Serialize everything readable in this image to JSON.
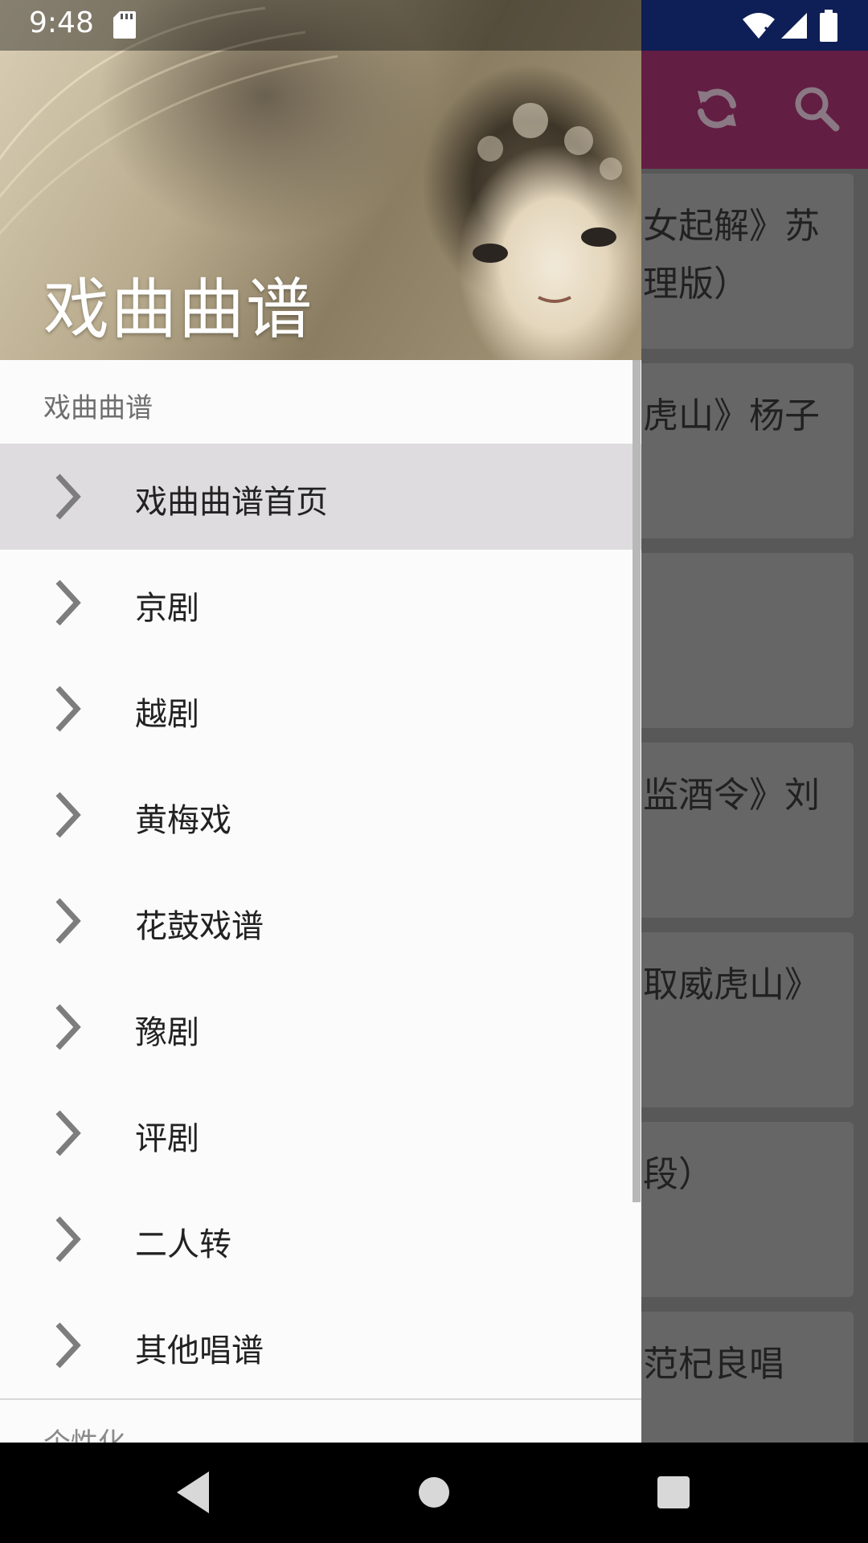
{
  "status": {
    "time": "9:48"
  },
  "drawer": {
    "title": "戏曲曲谱",
    "section_label": "戏曲曲谱",
    "items": [
      {
        "label": "戏曲曲谱首页",
        "active": true
      },
      {
        "label": "京剧"
      },
      {
        "label": "越剧"
      },
      {
        "label": "黄梅戏"
      },
      {
        "label": "花鼓戏谱"
      },
      {
        "label": "豫剧"
      },
      {
        "label": "评剧"
      },
      {
        "label": "二人转"
      },
      {
        "label": "其他唱谱"
      }
    ],
    "next_section_label": "个性化"
  },
  "background_list": [
    {
      "text": "女起解》苏\n理版）"
    },
    {
      "text": "虎山》杨子"
    },
    {
      "text": ""
    },
    {
      "text": "监酒令》刘"
    },
    {
      "text": "取威虎山》"
    },
    {
      "text": "段）"
    },
    {
      "text": "范杞良唱"
    }
  ],
  "toolbar": {
    "refresh_icon": "refresh-icon",
    "search_icon": "search-icon"
  },
  "colors": {
    "app_bar": "#8a2a5e",
    "status_right": "#0e1e56",
    "active_item": "#dedcdf"
  }
}
